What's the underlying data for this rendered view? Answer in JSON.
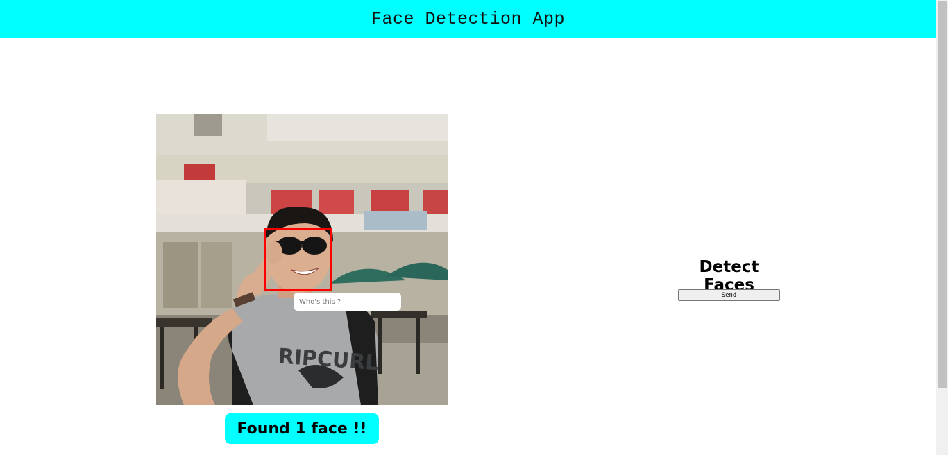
{
  "header": {
    "title": "Face Detection App"
  },
  "photo": {
    "face_input_placeholder": "Who's this ?",
    "shirt_text": "RIPCURL"
  },
  "result": {
    "label": "Found 1 face !!"
  },
  "detect": {
    "title": "Detect Faces",
    "send_label": "Send"
  },
  "colors": {
    "accent": "#00ffff",
    "face_box": "#ff0000"
  }
}
